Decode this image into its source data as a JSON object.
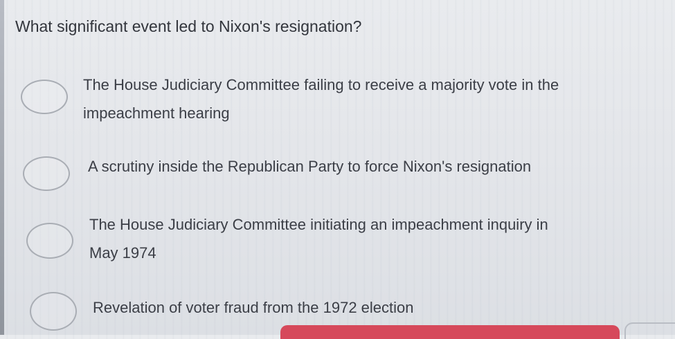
{
  "question": {
    "text": "What significant event led to Nixon's resignation?"
  },
  "options": [
    {
      "line1": "The House Judiciary Committee failing to receive a majority vote in the",
      "line2": "impeachment hearing"
    },
    {
      "line1": "A scrutiny inside the Republican Party to force Nixon's resignation",
      "line2": ""
    },
    {
      "line1": "The House Judiciary Committee initiating an impeachment inquiry in",
      "line2": "May 1974"
    },
    {
      "line1": "Revelation of voter fraud from the 1972 election",
      "line2": ""
    }
  ],
  "colors": {
    "background": "#e6e8ec",
    "text": "#3a3d45",
    "radio_border": "#a9adb4",
    "accent_bar": "#d6495b"
  }
}
